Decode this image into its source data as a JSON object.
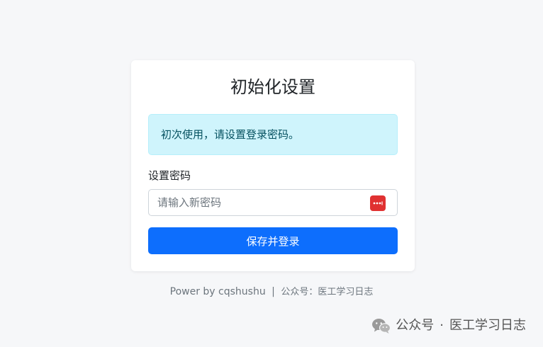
{
  "card": {
    "title": "初始化设置",
    "alert_text": "初次使用，请设置登录密码。",
    "password_label": "设置密码",
    "password_placeholder": "请输入新密码",
    "password_value": "",
    "submit_label": "保存并登录"
  },
  "footer": {
    "powered_by": "Power by cqshushu",
    "separator": "|",
    "public_account": "公众号：医工学习日志"
  },
  "watermark": {
    "icon": "wechat-icon",
    "label": "公众号",
    "dot": "·",
    "name": "医工学习日志"
  },
  "colors": {
    "accent": "#0d6efd",
    "alert_bg": "#cff4fc",
    "alert_text": "#055160",
    "password_icon": "#e03131",
    "page_bg": "#f6f7f9"
  }
}
